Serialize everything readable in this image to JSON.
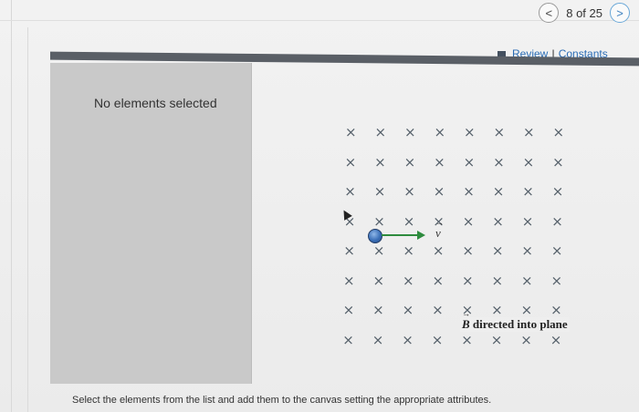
{
  "pager": {
    "prev_icon": "chevron-left-icon",
    "text": "8 of 25",
    "next_icon": "chevron-right-icon",
    "prev_glyph": "<",
    "next_glyph": ">"
  },
  "header": {
    "review_label": "Review",
    "separator": "I",
    "constants_label": "Constants"
  },
  "panel": {
    "status": "No elements selected"
  },
  "canvas": {
    "field_symbol": "×",
    "velocity_label": "v",
    "field_label_symbol": "B",
    "field_label_text": "directed into plane",
    "grid_rows": 8,
    "grid_cols": 8
  },
  "footer": {
    "instructions": "Select the elements from the list and add them to the canvas setting the appropriate attributes."
  },
  "colors": {
    "link": "#2a6cb5",
    "toolbar": "#5a5f66",
    "panel": "#c9c9c9",
    "velocity": "#2e8b3e",
    "particle": "#3a6fb8"
  }
}
